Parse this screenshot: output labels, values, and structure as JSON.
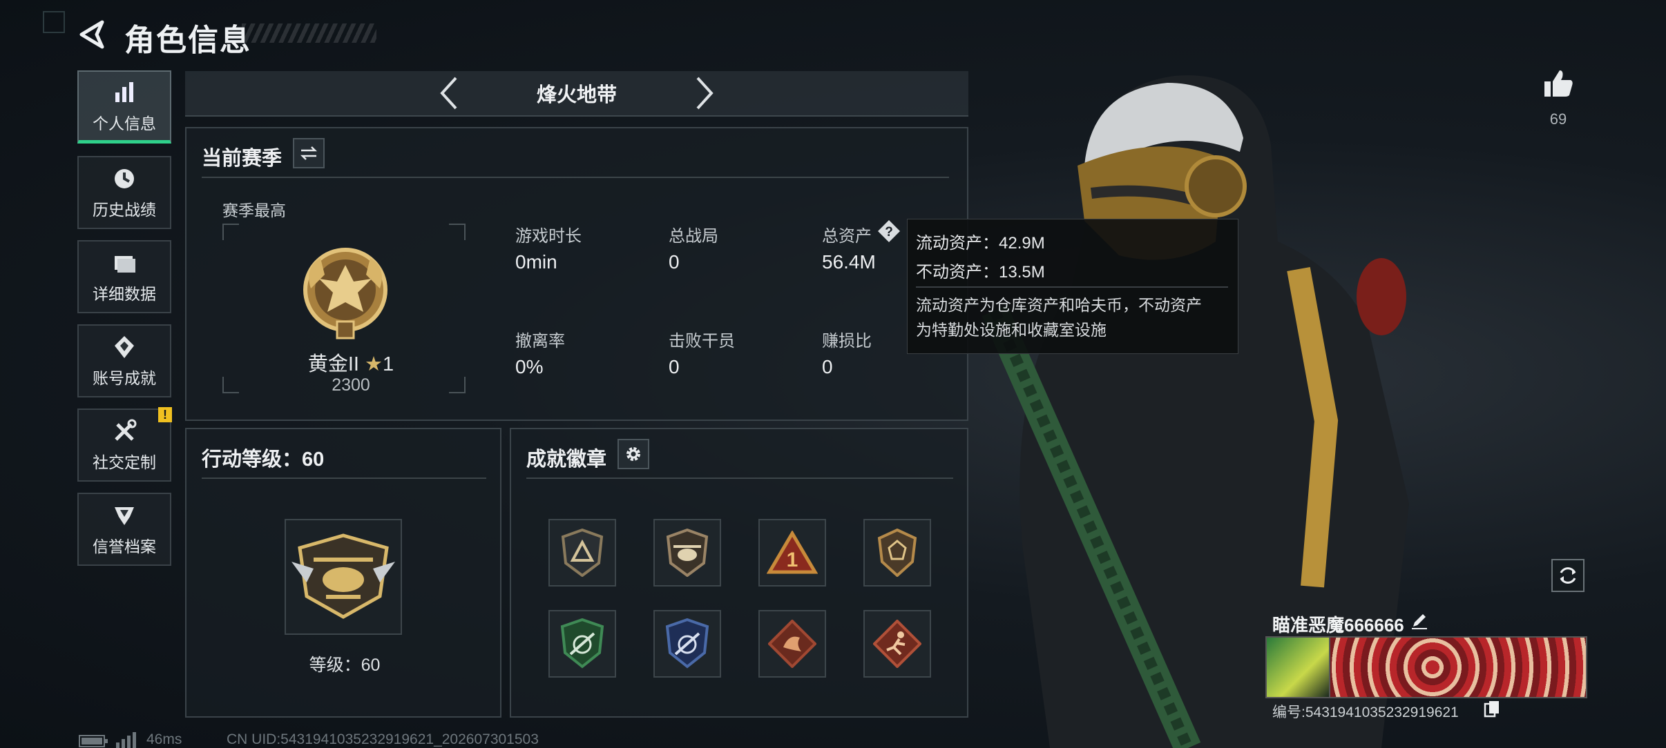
{
  "header": {
    "title": "角色信息"
  },
  "sidebar": {
    "items": [
      {
        "label": "个人信息",
        "icon": "bar-chart-icon",
        "active": true
      },
      {
        "label": "历史战绩",
        "icon": "history-clock-icon"
      },
      {
        "label": "详细数据",
        "icon": "folder-icon"
      },
      {
        "label": "账号成就",
        "icon": "achievement-icon"
      },
      {
        "label": "社交定制",
        "icon": "tools-icon",
        "badge": "!"
      },
      {
        "label": "信誉档案",
        "icon": "reputation-icon"
      }
    ]
  },
  "mode": {
    "name": "烽火地带"
  },
  "season": {
    "title": "当前赛季",
    "best_label": "赛季最高",
    "rank_name": "黄金II",
    "rank_stars": "1",
    "rank_points": "2300",
    "stats": [
      {
        "label": "游戏时长",
        "value": "0min"
      },
      {
        "label": "总战局",
        "value": "0"
      },
      {
        "label": "总资产",
        "value": "56.4M"
      },
      {
        "label": "撤离率",
        "value": "0%"
      },
      {
        "label": "击败干员",
        "value": "0"
      },
      {
        "label": "赚损比",
        "value": "0"
      }
    ]
  },
  "tooltip": {
    "liquid": "流动资产：42.9M",
    "fixed": "不动资产：13.5M",
    "note_line1": "流动资产为仓库资产和哈夫币，不动资产",
    "note_line2": "为特勤处设施和收藏室设施"
  },
  "action_level": {
    "title": "行动等级：60",
    "level_text": "等级：60"
  },
  "badges": {
    "title": "成就徽章",
    "items": [
      {
        "icon": "triangle-shield-badge",
        "color": "#8a7a5c"
      },
      {
        "icon": "helicopter-badge",
        "color": "#9a8466"
      },
      {
        "icon": "number-one-badge",
        "color": "#c88a3a"
      },
      {
        "icon": "lion-shield-badge",
        "color": "#b58a4a"
      },
      {
        "icon": "green-shield-badge",
        "color": "#3f8a55"
      },
      {
        "icon": "blue-shield-badge",
        "color": "#4a6aa8"
      },
      {
        "icon": "dragon-diamond-badge",
        "color": "#a04832"
      },
      {
        "icon": "runner-diamond-badge",
        "color": "#b05038"
      }
    ]
  },
  "profile": {
    "likes": "69",
    "name": "瞄准恶魔666666",
    "id_text": "编号:5431941035232919621"
  },
  "status": {
    "ping": "46ms",
    "uid": "CN UID:5431941035232919621_202607301503"
  },
  "colors": {
    "accent": "#2fd08a",
    "warning": "#f0c020"
  }
}
